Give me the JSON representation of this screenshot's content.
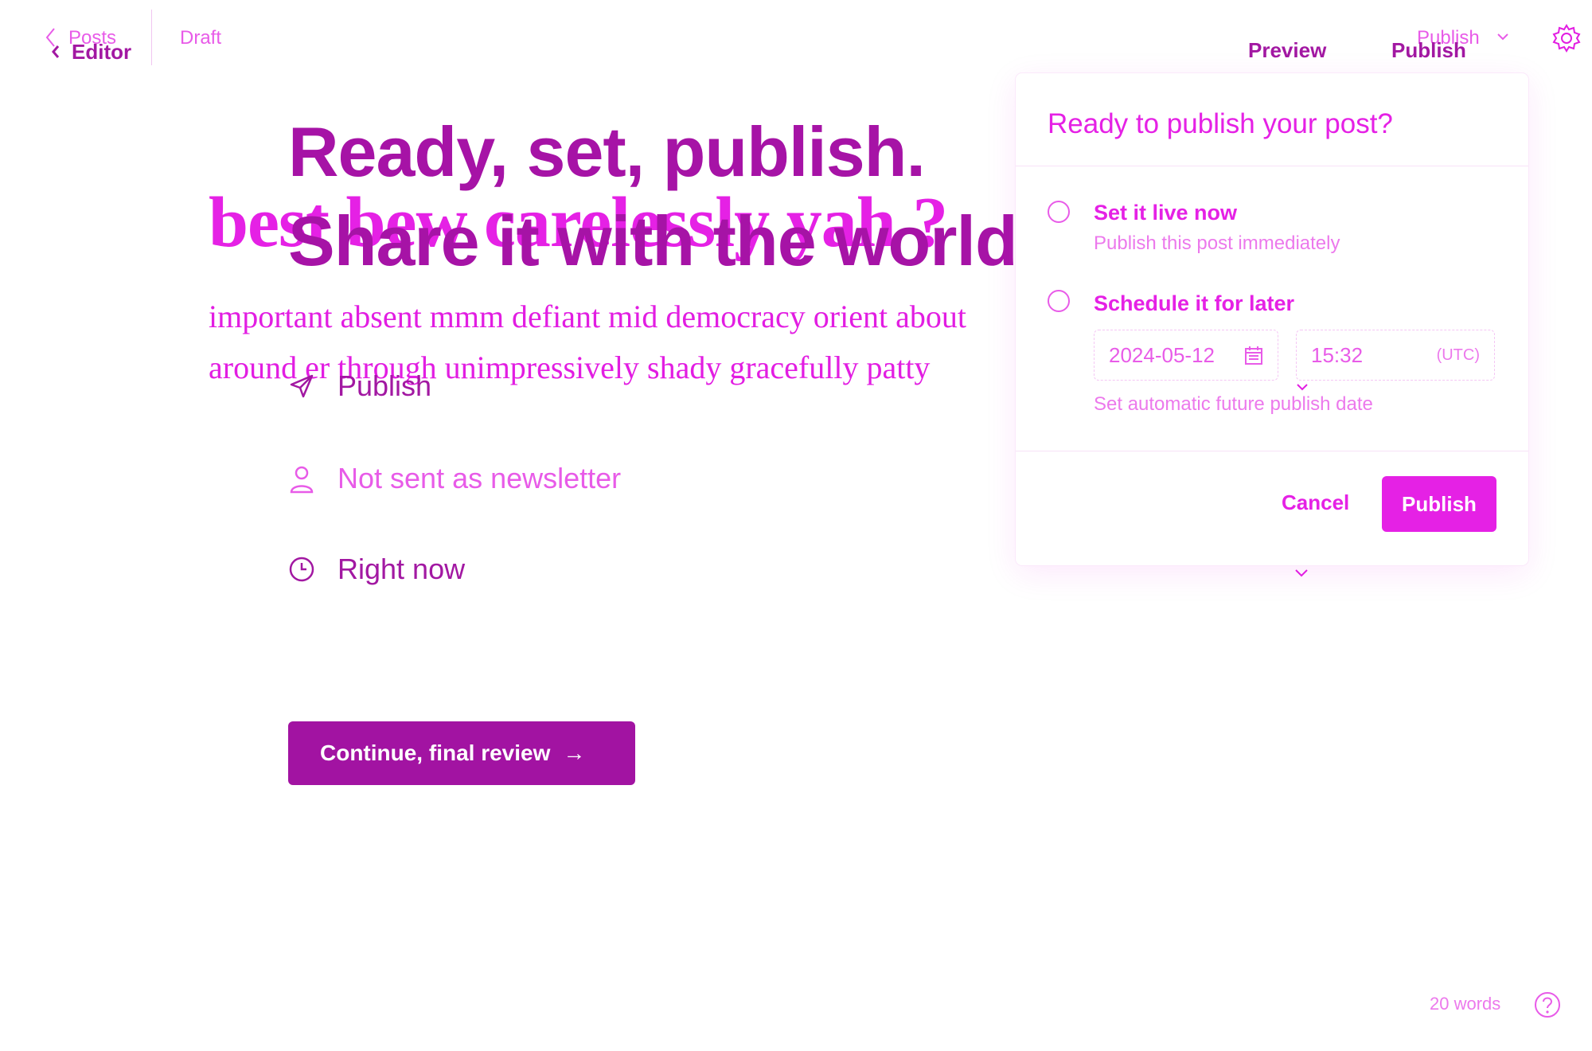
{
  "background_editor": {
    "back_label": "Posts",
    "status": "Draft",
    "publish_menu_label": "Publish",
    "post_title": "best bew carelessly yah ?",
    "body_lines": [
      "important absent mmm defiant mid democracy orient about",
      "around er through unimpressively shady gracefully patty"
    ]
  },
  "publish_flow": {
    "back_label": "Editor",
    "preview_label": "Preview",
    "publish_label": "Publish",
    "heading_lines": [
      "Ready, set, publish.",
      "Share it with the world."
    ],
    "rows": [
      {
        "icon": "send-icon",
        "label": "Publish"
      },
      {
        "icon": "user-icon",
        "label": "Not sent as newsletter"
      },
      {
        "icon": "clock-icon",
        "label": "Right now"
      }
    ],
    "continue_label": "Continue, final review",
    "continue_arrow": "→"
  },
  "modal": {
    "title": "Ready to publish your post?",
    "options": [
      {
        "title": "Set it live now",
        "subtitle": "Publish this post immediately"
      },
      {
        "title": "Schedule it for later"
      }
    ],
    "date_value": "2024-05-12",
    "time_value": "15:32",
    "timezone": "(UTC)",
    "hint": "Set automatic future publish date",
    "cancel_label": "Cancel",
    "publish_label": "Publish"
  },
  "footer": {
    "word_count": "20 words"
  },
  "colors": {
    "accent": "#e21de2",
    "accent_dark": "#a213a2",
    "background": "#ffffff"
  }
}
